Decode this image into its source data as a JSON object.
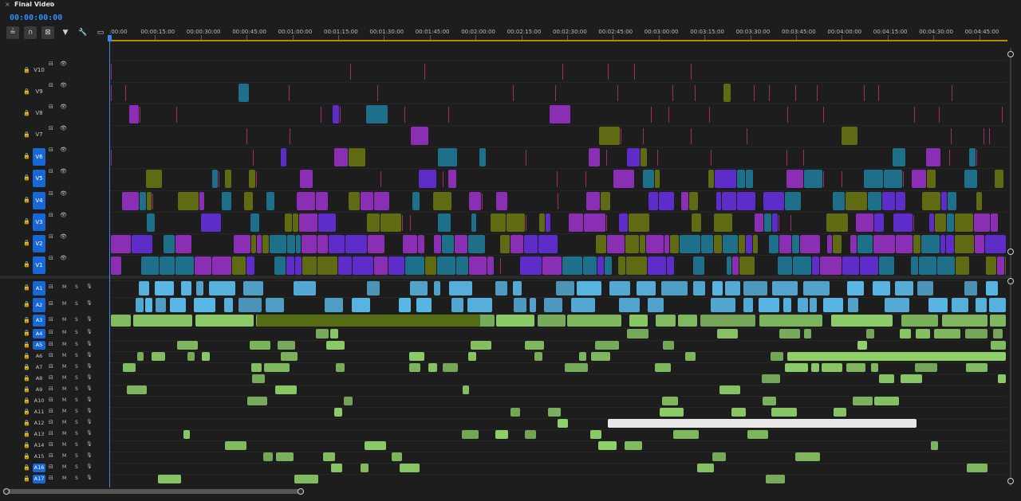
{
  "panel": {
    "close_glyph": "×",
    "title": "Final Video",
    "menu_glyph": "≡",
    "timecode": "00:00:00:00"
  },
  "toolbar": {
    "tools": [
      {
        "name": "nest-sequence-icon",
        "glyph": "≟"
      },
      {
        "name": "snap-magnet-icon",
        "glyph": "∩"
      },
      {
        "name": "linked-selection-icon",
        "glyph": "⊠"
      },
      {
        "name": "add-marker-icon",
        "glyph": "▼"
      },
      {
        "name": "timeline-settings-wrench-icon",
        "glyph": "🔧"
      },
      {
        "name": "captions-icon",
        "glyph": "▭"
      }
    ]
  },
  "ruler": {
    "labels": [
      ":00:00",
      "00:00:15:00",
      "00:00:30:00",
      "00:00:45:00",
      "00:01:00:00",
      "00:01:15:00",
      "00:01:30:00",
      "00:01:45:00",
      "00:02:00:00",
      "00:02:15:00",
      "00:02:30:00",
      "00:02:45:00",
      "00:03:00:00",
      "00:03:15:00",
      "00:03:30:00",
      "00:03:45:00",
      "00:04:00:00",
      "00:04:15:00",
      "00:04:30:00",
      "00:04:45:00"
    ]
  },
  "video_tracks": [
    {
      "label": "V10",
      "targeted": false
    },
    {
      "label": "V9",
      "targeted": false
    },
    {
      "label": "V8",
      "targeted": false
    },
    {
      "label": "V7",
      "targeted": false
    },
    {
      "label": "V6",
      "targeted": true
    },
    {
      "label": "V5",
      "targeted": true
    },
    {
      "label": "V4",
      "targeted": true
    },
    {
      "label": "V3",
      "targeted": true
    },
    {
      "label": "V2",
      "targeted": true
    },
    {
      "label": "V1",
      "targeted": true
    }
  ],
  "audio_tracks": [
    {
      "label": "A1",
      "targeted": true
    },
    {
      "label": "A2",
      "targeted": true
    },
    {
      "label": "A3",
      "targeted": true
    },
    {
      "label": "A4",
      "targeted": true
    },
    {
      "label": "A5",
      "targeted": true
    },
    {
      "label": "A6",
      "targeted": false
    },
    {
      "label": "A7",
      "targeted": false
    },
    {
      "label": "A8",
      "targeted": false
    },
    {
      "label": "A9",
      "targeted": false
    },
    {
      "label": "A10",
      "targeted": false
    },
    {
      "label": "A11",
      "targeted": false
    },
    {
      "label": "A12",
      "targeted": false
    },
    {
      "label": "A13",
      "targeted": false
    },
    {
      "label": "A14",
      "targeted": false
    },
    {
      "label": "A15",
      "targeted": false
    },
    {
      "label": "A16",
      "targeted": true
    },
    {
      "label": "A17",
      "targeted": true
    }
  ],
  "track_controls": {
    "lock_glyph": "🔒",
    "sync_glyph": "⊟",
    "eye_glyph": "👁",
    "mute_label": "M",
    "solo_label": "S",
    "mic_glyph": "🎙"
  },
  "colors": {
    "playhead": "#3b86e6",
    "accent_blue": "#1768d6",
    "clip_teal": "#1d6f8a",
    "clip_purple": "#8a2fb3",
    "clip_violet": "#5d2cc9",
    "clip_olive": "#5f6a12",
    "clip_magenta": "#a62b6a",
    "audio_blue": "#5ab9e8",
    "audio_green": "#8fd06a",
    "audio_olive": "#556b14"
  }
}
